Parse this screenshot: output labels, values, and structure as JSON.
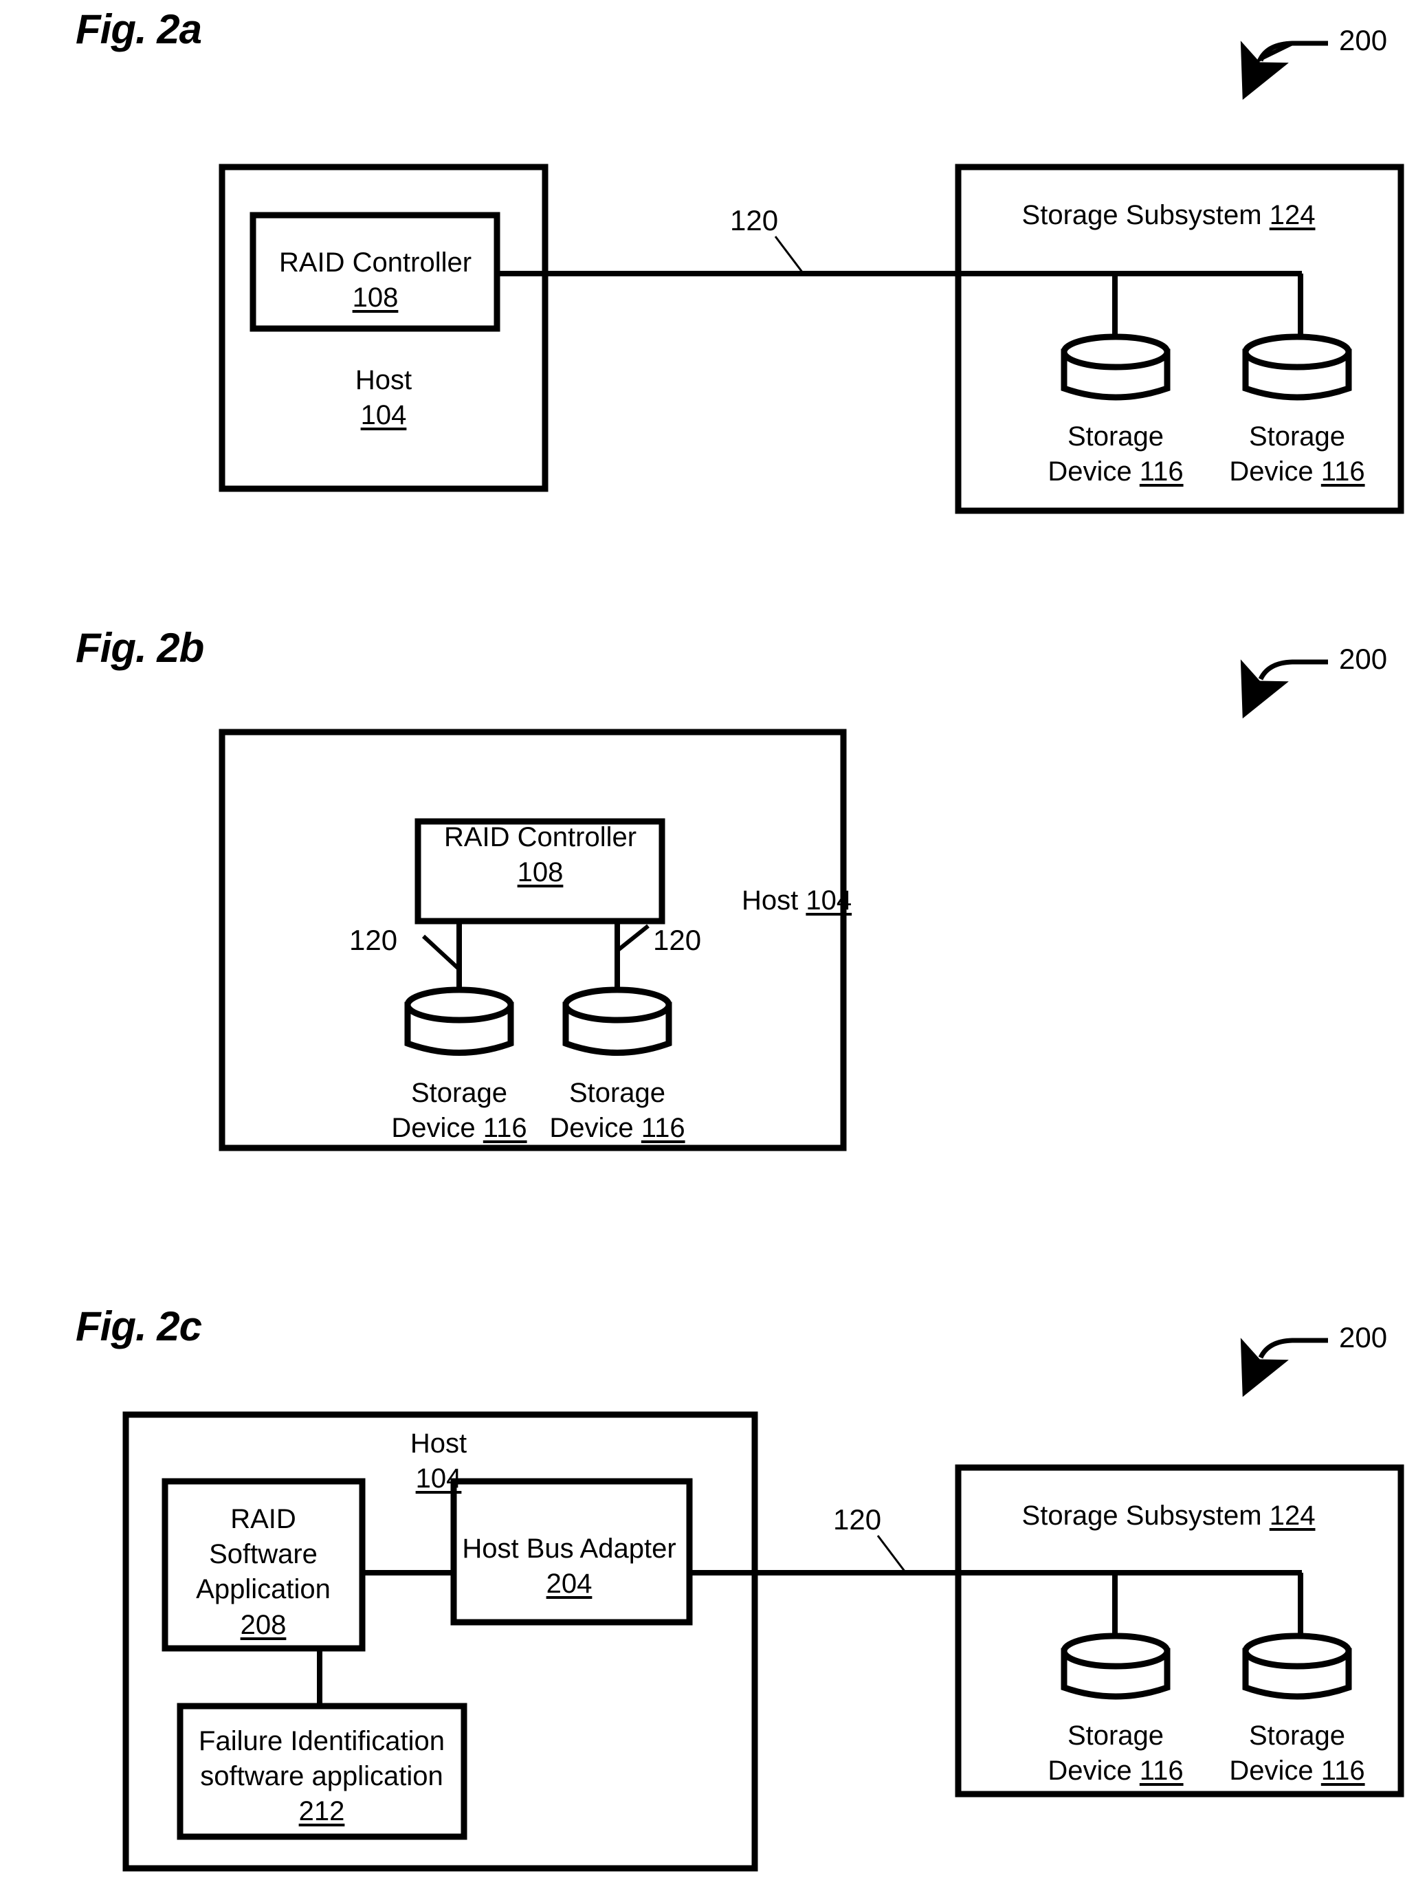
{
  "sheet": {
    "background": "#ffffff",
    "ink": "#000000"
  },
  "figures": [
    {
      "id": "fig-2a",
      "label": "Fig. 2a",
      "callout": "200",
      "link_label": "120",
      "blocks": [
        {
          "id": "host",
          "lines": [
            "Host"
          ],
          "ref": "104"
        },
        {
          "id": "raid-controller",
          "lines": [
            "RAID Controller"
          ],
          "ref": "108"
        },
        {
          "id": "storage-subsystem",
          "lines": [
            "Storage Subsystem"
          ],
          "ref": "124"
        },
        {
          "id": "storage-device-left",
          "lines": [
            "Storage",
            "Device"
          ],
          "ref": "116"
        },
        {
          "id": "storage-device-right",
          "lines": [
            "Storage",
            "Device"
          ],
          "ref": "116"
        }
      ]
    },
    {
      "id": "fig-2b",
      "label": "Fig. 2b",
      "callout": "200",
      "link_label_left": "120",
      "link_label_right": "120",
      "blocks": [
        {
          "id": "host",
          "lines": [
            "Host"
          ],
          "ref": "104"
        },
        {
          "id": "raid-controller",
          "lines": [
            "RAID Controller"
          ],
          "ref": "108"
        },
        {
          "id": "storage-device-left",
          "lines": [
            "Storage",
            "Device"
          ],
          "ref": "116"
        },
        {
          "id": "storage-device-right",
          "lines": [
            "Storage",
            "Device"
          ],
          "ref": "116"
        }
      ]
    },
    {
      "id": "fig-2c",
      "label": "Fig. 2c",
      "callout": "200",
      "link_label": "120",
      "blocks": [
        {
          "id": "host",
          "lines": [
            "Host"
          ],
          "ref": "104"
        },
        {
          "id": "raid-software-application",
          "lines": [
            "RAID",
            "Software",
            "Application"
          ],
          "ref": "208"
        },
        {
          "id": "host-bus-adapter",
          "lines": [
            "Host Bus Adapter"
          ],
          "ref": "204"
        },
        {
          "id": "failure-identification",
          "lines": [
            "Failure Identification",
            "software application"
          ],
          "ref": "212"
        },
        {
          "id": "storage-subsystem",
          "lines": [
            "Storage Subsystem"
          ],
          "ref": "124"
        },
        {
          "id": "storage-device-left",
          "lines": [
            "Storage",
            "Device"
          ],
          "ref": "116"
        },
        {
          "id": "storage-device-right",
          "lines": [
            "Storage",
            "Device"
          ],
          "ref": "116"
        }
      ]
    }
  ],
  "fig2a": {
    "label": "Fig. 2a",
    "callout": "200",
    "link": "120",
    "host_name": "Host",
    "host_ref": "104",
    "raid_name": "RAID Controller",
    "raid_ref": "108",
    "subsystem_name": "Storage Subsystem",
    "subsystem_ref": "124",
    "dev1_l1": "Storage",
    "dev1_l2": "Device",
    "dev1_ref": "116",
    "dev2_l1": "Storage",
    "dev2_l2": "Device",
    "dev2_ref": "116"
  },
  "fig2b": {
    "label": "Fig. 2b",
    "callout": "200",
    "link_left": "120",
    "link_right": "120",
    "host_name": "Host",
    "host_ref": "104",
    "raid_name": "RAID Controller",
    "raid_ref": "108",
    "dev1_l1": "Storage",
    "dev1_l2": "Device",
    "dev1_ref": "116",
    "dev2_l1": "Storage",
    "dev2_l2": "Device",
    "dev2_ref": "116"
  },
  "fig2c": {
    "label": "Fig. 2c",
    "callout": "200",
    "link": "120",
    "host_name": "Host",
    "host_ref": "104",
    "raid_l1": "RAID",
    "raid_l2": "Software",
    "raid_l3": "Application",
    "raid_ref": "208",
    "hba_name": "Host Bus Adapter",
    "hba_ref": "204",
    "fail_l1": "Failure Identification",
    "fail_l2": "software application",
    "fail_ref": "212",
    "subsystem_name": "Storage Subsystem",
    "subsystem_ref": "124",
    "dev1_l1": "Storage",
    "dev1_l2": "Device",
    "dev1_ref": "116",
    "dev2_l1": "Storage",
    "dev2_l2": "Device",
    "dev2_ref": "116"
  }
}
